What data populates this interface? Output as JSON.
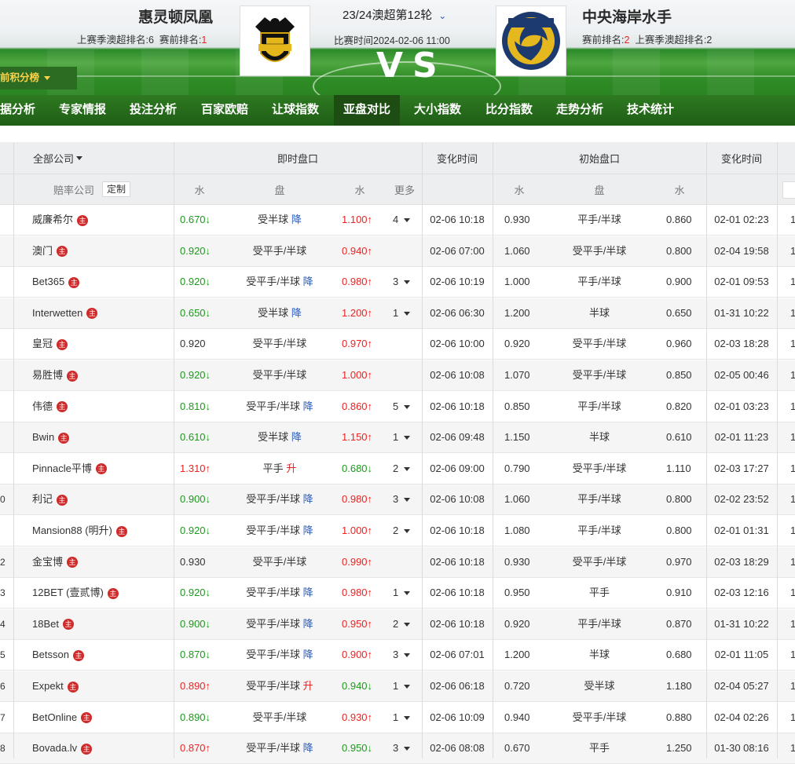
{
  "home": {
    "name": "惠灵顿凤凰",
    "prev_rank_label": "上赛季澳超排名:6",
    "cur_rank_prefix": "赛前排名:",
    "cur_rank": "1",
    "logo_text": "WELLINGTON"
  },
  "away": {
    "name": "中央海岸水手",
    "cur_rank_prefix": "赛前排名:",
    "cur_rank": "2",
    "prev_rank_label": "上赛季澳超排名:2",
    "logo_text": "MARINERS"
  },
  "match": {
    "round": "23/24澳超第12轮",
    "time_label": "比赛时间2024-02-06 11:00",
    "vs": "VS"
  },
  "rank_button": "前积分榜",
  "nav": [
    "据分析",
    "专家情报",
    "投注分析",
    "百家欧赔",
    "让球指数",
    "亚盘对比",
    "大小指数",
    "比分指数",
    "走势分析",
    "技术统计"
  ],
  "nav_active": 5,
  "table": {
    "all_companies": "全部公司",
    "live": "即时盘口",
    "change_time": "变化时间",
    "initial": "初始盘口",
    "change_time2": "变化时间",
    "company_col": "赔率公司",
    "custom": "定制",
    "water": "水",
    "handicap": "盘",
    "more": "更多",
    "zhu": "主",
    "rows": [
      {
        "idx": "",
        "name": "威廉希尔",
        "lw": "0.670",
        "lwd": "↓",
        "lwc": "g",
        "hc": "受半球",
        "tag": "降",
        "tagc": "blue",
        "rw": "1.100",
        "rwd": "↑",
        "rwc": "r",
        "more": "4",
        "t1": "02-06 10:18",
        "iw": "0.930",
        "ih": "平手/半球",
        "iw2": "0.860",
        "t2": "02-01 02:23"
      },
      {
        "idx": "",
        "name": "澳门",
        "lw": "0.920",
        "lwd": "↓",
        "lwc": "g",
        "hc": "受平手/半球",
        "tag": "",
        "tagc": "",
        "rw": "0.940",
        "rwd": "↑",
        "rwc": "r",
        "more": "",
        "t1": "02-06 07:00",
        "iw": "1.060",
        "ih": "受平手/半球",
        "iw2": "0.800",
        "t2": "02-04 19:58"
      },
      {
        "idx": "",
        "name": "Bet365",
        "lw": "0.920",
        "lwd": "↓",
        "lwc": "g",
        "hc": "受平手/半球",
        "tag": "降",
        "tagc": "blue",
        "rw": "0.980",
        "rwd": "↑",
        "rwc": "r",
        "more": "3",
        "t1": "02-06 10:19",
        "iw": "1.000",
        "ih": "平手/半球",
        "iw2": "0.900",
        "t2": "02-01 09:53"
      },
      {
        "idx": "",
        "name": "Interwetten",
        "lw": "0.650",
        "lwd": "↓",
        "lwc": "g",
        "hc": "受半球",
        "tag": "降",
        "tagc": "blue",
        "rw": "1.200",
        "rwd": "↑",
        "rwc": "r",
        "more": "1",
        "t1": "02-06 06:30",
        "iw": "1.200",
        "ih": "半球",
        "iw2": "0.650",
        "t2": "01-31 10:22"
      },
      {
        "idx": "",
        "name": "皇冠",
        "lw": "0.920",
        "lwd": "",
        "lwc": "n",
        "hc": "受平手/半球",
        "tag": "",
        "tagc": "",
        "rw": "0.970",
        "rwd": "↑",
        "rwc": "r",
        "more": "",
        "t1": "02-06 10:00",
        "iw": "0.920",
        "ih": "受平手/半球",
        "iw2": "0.960",
        "t2": "02-03 18:28"
      },
      {
        "idx": "",
        "name": "易胜博",
        "lw": "0.920",
        "lwd": "↓",
        "lwc": "g",
        "hc": "受平手/半球",
        "tag": "",
        "tagc": "",
        "rw": "1.000",
        "rwd": "↑",
        "rwc": "r",
        "more": "",
        "t1": "02-06 10:08",
        "iw": "1.070",
        "ih": "受平手/半球",
        "iw2": "0.850",
        "t2": "02-05 00:46"
      },
      {
        "idx": "",
        "name": "伟德",
        "lw": "0.810",
        "lwd": "↓",
        "lwc": "g",
        "hc": "受平手/半球",
        "tag": "降",
        "tagc": "blue",
        "rw": "0.860",
        "rwd": "↑",
        "rwc": "r",
        "more": "5",
        "t1": "02-06 10:18",
        "iw": "0.850",
        "ih": "平手/半球",
        "iw2": "0.820",
        "t2": "02-01 03:23"
      },
      {
        "idx": "",
        "name": "Bwin",
        "lw": "0.610",
        "lwd": "↓",
        "lwc": "g",
        "hc": "受半球",
        "tag": "降",
        "tagc": "blue",
        "rw": "1.150",
        "rwd": "↑",
        "rwc": "r",
        "more": "1",
        "t1": "02-06 09:48",
        "iw": "1.150",
        "ih": "半球",
        "iw2": "0.610",
        "t2": "02-01 11:23"
      },
      {
        "idx": "",
        "name": "Pinnacle平博",
        "lw": "1.310",
        "lwd": "↑",
        "lwc": "r",
        "hc": "平手",
        "tag": "升",
        "tagc": "r",
        "rw": "0.680",
        "rwd": "↓",
        "rwc": "g",
        "more": "2",
        "t1": "02-06 09:00",
        "iw": "0.790",
        "ih": "受平手/半球",
        "iw2": "1.110",
        "t2": "02-03 17:27"
      },
      {
        "idx": "0",
        "name": "利记",
        "lw": "0.900",
        "lwd": "↓",
        "lwc": "g",
        "hc": "受平手/半球",
        "tag": "降",
        "tagc": "blue",
        "rw": "0.980",
        "rwd": "↑",
        "rwc": "r",
        "more": "3",
        "t1": "02-06 10:08",
        "iw": "1.060",
        "ih": "平手/半球",
        "iw2": "0.800",
        "t2": "02-02 23:52"
      },
      {
        "idx": "",
        "name": "Mansion88 (明升)",
        "lw": "0.920",
        "lwd": "↓",
        "lwc": "g",
        "hc": "受平手/半球",
        "tag": "降",
        "tagc": "blue",
        "rw": "1.000",
        "rwd": "↑",
        "rwc": "r",
        "more": "2",
        "t1": "02-06 10:18",
        "iw": "1.080",
        "ih": "平手/半球",
        "iw2": "0.800",
        "t2": "02-01 01:31"
      },
      {
        "idx": "2",
        "name": "金宝博",
        "lw": "0.930",
        "lwd": "",
        "lwc": "n",
        "hc": "受平手/半球",
        "tag": "",
        "tagc": "",
        "rw": "0.990",
        "rwd": "↑",
        "rwc": "r",
        "more": "",
        "t1": "02-06 10:18",
        "iw": "0.930",
        "ih": "受平手/半球",
        "iw2": "0.970",
        "t2": "02-03 18:29"
      },
      {
        "idx": "3",
        "name": "12BET (壹贰博)",
        "lw": "0.920",
        "lwd": "↓",
        "lwc": "g",
        "hc": "受平手/半球",
        "tag": "降",
        "tagc": "blue",
        "rw": "0.980",
        "rwd": "↑",
        "rwc": "r",
        "more": "1",
        "t1": "02-06 10:18",
        "iw": "0.950",
        "ih": "平手",
        "iw2": "0.910",
        "t2": "02-03 12:16"
      },
      {
        "idx": "4",
        "name": "18Bet",
        "lw": "0.900",
        "lwd": "↓",
        "lwc": "g",
        "hc": "受平手/半球",
        "tag": "降",
        "tagc": "blue",
        "rw": "0.950",
        "rwd": "↑",
        "rwc": "r",
        "more": "2",
        "t1": "02-06 10:18",
        "iw": "0.920",
        "ih": "平手/半球",
        "iw2": "0.870",
        "t2": "01-31 10:22"
      },
      {
        "idx": "5",
        "name": "Betsson",
        "lw": "0.870",
        "lwd": "↓",
        "lwc": "g",
        "hc": "受平手/半球",
        "tag": "降",
        "tagc": "blue",
        "rw": "0.900",
        "rwd": "↑",
        "rwc": "r",
        "more": "3",
        "t1": "02-06 07:01",
        "iw": "1.200",
        "ih": "半球",
        "iw2": "0.680",
        "t2": "02-01 11:05"
      },
      {
        "idx": "6",
        "name": "Expekt",
        "lw": "0.890",
        "lwd": "↑",
        "lwc": "r",
        "hc": "受平手/半球",
        "tag": "升",
        "tagc": "r",
        "rw": "0.940",
        "rwd": "↓",
        "rwc": "g",
        "more": "1",
        "t1": "02-06 06:18",
        "iw": "0.720",
        "ih": "受半球",
        "iw2": "1.180",
        "t2": "02-04 05:27"
      },
      {
        "idx": "7",
        "name": "BetOnline",
        "lw": "0.890",
        "lwd": "↓",
        "lwc": "g",
        "hc": "受平手/半球",
        "tag": "",
        "tagc": "",
        "rw": "0.930",
        "rwd": "↑",
        "rwc": "r",
        "more": "1",
        "t1": "02-06 10:09",
        "iw": "0.940",
        "ih": "受平手/半球",
        "iw2": "0.880",
        "t2": "02-04 02:26"
      },
      {
        "idx": "8",
        "name": "Bovada.lv",
        "lw": "0.870",
        "lwd": "↑",
        "lwc": "r",
        "hc": "受平手/半球",
        "tag": "降",
        "tagc": "blue",
        "rw": "0.950",
        "rwd": "↓",
        "rwc": "g",
        "more": "3",
        "t1": "02-06 08:08",
        "iw": "0.670",
        "ih": "平手",
        "iw2": "1.250",
        "t2": "01-30 08:16"
      }
    ]
  }
}
